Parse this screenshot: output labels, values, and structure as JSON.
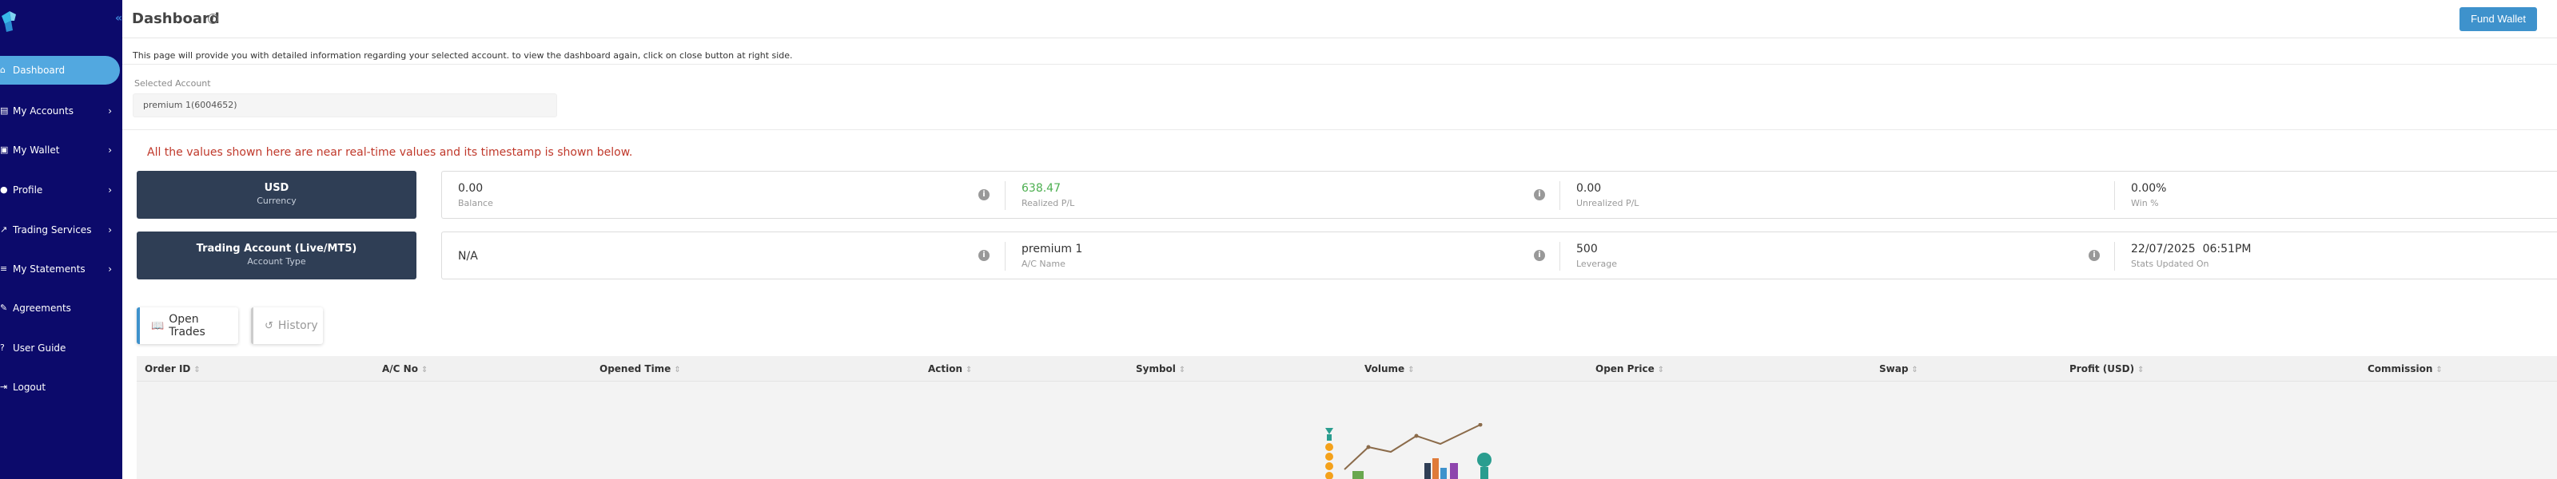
{
  "header": {
    "title": "Dashboard",
    "fund_button": "Fund Wallet"
  },
  "sidebar": {
    "items": [
      {
        "label": "Dashboard",
        "icon": "home-icon",
        "has_chevron": false,
        "active": true
      },
      {
        "label": "My Accounts",
        "icon": "accounts-icon",
        "has_chevron": true,
        "active": false
      },
      {
        "label": "My Wallet",
        "icon": "wallet-icon",
        "has_chevron": true,
        "active": false
      },
      {
        "label": "Profile",
        "icon": "profile-icon",
        "has_chevron": true,
        "active": false
      },
      {
        "label": "Trading Services",
        "icon": "chart-icon",
        "has_chevron": true,
        "active": false
      },
      {
        "label": "My Statements",
        "icon": "statements-icon",
        "has_chevron": true,
        "active": false
      },
      {
        "label": "Agreements",
        "icon": "agreements-icon",
        "has_chevron": false,
        "active": false
      },
      {
        "label": "User Guide",
        "icon": "guide-icon",
        "has_chevron": false,
        "active": false
      },
      {
        "label": "Logout",
        "icon": "logout-icon",
        "has_chevron": false,
        "active": false
      }
    ]
  },
  "intro": {
    "text": "This page will provide you with detailed information regarding your selected account. to view the dashboard again, click on close button at right side."
  },
  "account": {
    "label": "Selected Account",
    "value": "premium 1(6004652)"
  },
  "notice": "All the values shown here are near real-time values and its timestamp is shown below.",
  "cards": {
    "currency": {
      "value": "USD",
      "label": "Currency"
    },
    "account_type": {
      "value": "Trading Account (Live/MT5)",
      "label": "Account Type"
    }
  },
  "stats_row1": [
    {
      "value": "0.00",
      "label": "Balance"
    },
    {
      "value": "638.47",
      "label": "Realized P/L"
    },
    {
      "value": "0.00",
      "label": "Unrealized P/L"
    },
    {
      "value": "0.00%",
      "label": "Win %"
    }
  ],
  "stats_row2": [
    {
      "value": "N/A",
      "label": ""
    },
    {
      "value": "premium 1",
      "label": "A/C Name"
    },
    {
      "value": "500",
      "label": "Leverage"
    },
    {
      "value": "22/07/2025  06:51PM",
      "label": "Stats Updated On"
    }
  ],
  "tabs": {
    "open_trades": "Open Trades",
    "history": "History"
  },
  "table": {
    "columns": [
      "Order ID",
      "A/C No",
      "Opened Time",
      "Action",
      "Symbol",
      "Volume",
      "Open Price",
      "Swap",
      "Profit (USD)",
      "Commission"
    ]
  },
  "colors": {
    "sidebar_bg": "#0c0a6b",
    "accent": "#3e92cc",
    "notice": "#c0392b",
    "positive": "#4caf50",
    "card_dark": "#2f3e55"
  }
}
